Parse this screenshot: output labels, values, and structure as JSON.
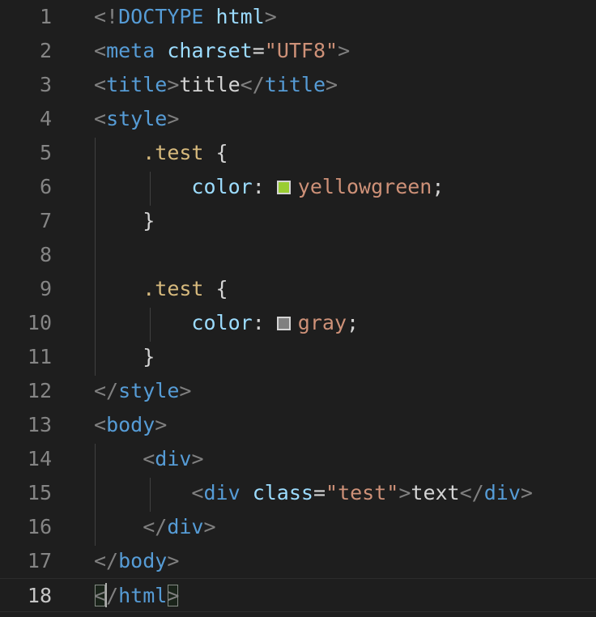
{
  "editor": {
    "lines": [
      {
        "number": "1",
        "tokens": [
          {
            "t": "<!",
            "k": "punct"
          },
          {
            "t": "DOCTYPE",
            "k": "tag"
          },
          {
            "t": " ",
            "k": "text"
          },
          {
            "t": "html",
            "k": "attr"
          },
          {
            "t": ">",
            "k": "punct"
          }
        ]
      },
      {
        "number": "2",
        "tokens": [
          {
            "t": "<",
            "k": "punct"
          },
          {
            "t": "meta",
            "k": "tag"
          },
          {
            "t": " ",
            "k": "text"
          },
          {
            "t": "charset",
            "k": "attr"
          },
          {
            "t": "=",
            "k": "text"
          },
          {
            "t": "\"UTF8\"",
            "k": "str"
          },
          {
            "t": ">",
            "k": "punct"
          }
        ]
      },
      {
        "number": "3",
        "tokens": [
          {
            "t": "<",
            "k": "punct"
          },
          {
            "t": "title",
            "k": "tag"
          },
          {
            "t": ">",
            "k": "punct"
          },
          {
            "t": "title",
            "k": "text"
          },
          {
            "t": "</",
            "k": "punct"
          },
          {
            "t": "title",
            "k": "tag"
          },
          {
            "t": ">",
            "k": "punct"
          }
        ]
      },
      {
        "number": "4",
        "tokens": [
          {
            "t": "<",
            "k": "punct"
          },
          {
            "t": "style",
            "k": "tag"
          },
          {
            "t": ">",
            "k": "punct"
          }
        ]
      },
      {
        "number": "5",
        "tokens": [
          {
            "t": "    ",
            "k": "text"
          },
          {
            "t": ".test",
            "k": "sel"
          },
          {
            "t": " {",
            "k": "text"
          }
        ]
      },
      {
        "number": "6",
        "tokens": [
          {
            "t": "        ",
            "k": "text"
          },
          {
            "t": "color",
            "k": "prop"
          },
          {
            "t": ": ",
            "k": "text"
          },
          {
            "swatch": "#9acd32",
            "name": "swatch-yellowgreen"
          },
          {
            "t": "yellowgreen",
            "k": "val"
          },
          {
            "t": ";",
            "k": "text"
          }
        ]
      },
      {
        "number": "7",
        "tokens": [
          {
            "t": "    }",
            "k": "text"
          }
        ]
      },
      {
        "number": "8",
        "tokens": []
      },
      {
        "number": "9",
        "tokens": [
          {
            "t": "    ",
            "k": "text"
          },
          {
            "t": ".test",
            "k": "sel"
          },
          {
            "t": " {",
            "k": "text"
          }
        ]
      },
      {
        "number": "10",
        "tokens": [
          {
            "t": "        ",
            "k": "text"
          },
          {
            "t": "color",
            "k": "prop"
          },
          {
            "t": ": ",
            "k": "text"
          },
          {
            "swatch": "#808080",
            "name": "swatch-gray"
          },
          {
            "t": "gray",
            "k": "val"
          },
          {
            "t": ";",
            "k": "text"
          }
        ]
      },
      {
        "number": "11",
        "tokens": [
          {
            "t": "    }",
            "k": "text"
          }
        ]
      },
      {
        "number": "12",
        "tokens": [
          {
            "t": "</",
            "k": "punct"
          },
          {
            "t": "style",
            "k": "tag"
          },
          {
            "t": ">",
            "k": "punct"
          }
        ]
      },
      {
        "number": "13",
        "tokens": [
          {
            "t": "<",
            "k": "punct"
          },
          {
            "t": "body",
            "k": "tag"
          },
          {
            "t": ">",
            "k": "punct"
          }
        ]
      },
      {
        "number": "14",
        "tokens": [
          {
            "t": "    ",
            "k": "text"
          },
          {
            "t": "<",
            "k": "punct"
          },
          {
            "t": "div",
            "k": "tag"
          },
          {
            "t": ">",
            "k": "punct"
          }
        ]
      },
      {
        "number": "15",
        "tokens": [
          {
            "t": "        ",
            "k": "text"
          },
          {
            "t": "<",
            "k": "punct"
          },
          {
            "t": "div",
            "k": "tag"
          },
          {
            "t": " ",
            "k": "text"
          },
          {
            "t": "class",
            "k": "attr"
          },
          {
            "t": "=",
            "k": "text"
          },
          {
            "t": "\"test\"",
            "k": "str"
          },
          {
            "t": ">",
            "k": "punct"
          },
          {
            "t": "text",
            "k": "text"
          },
          {
            "t": "</",
            "k": "punct"
          },
          {
            "t": "div",
            "k": "tag"
          },
          {
            "t": ">",
            "k": "punct"
          }
        ]
      },
      {
        "number": "16",
        "tokens": [
          {
            "t": "    ",
            "k": "text"
          },
          {
            "t": "</",
            "k": "punct"
          },
          {
            "t": "div",
            "k": "tag"
          },
          {
            "t": ">",
            "k": "punct"
          }
        ]
      },
      {
        "number": "17",
        "tokens": [
          {
            "t": "</",
            "k": "punct"
          },
          {
            "t": "body",
            "k": "tag"
          },
          {
            "t": ">",
            "k": "punct"
          }
        ]
      },
      {
        "number": "18",
        "current": true,
        "tokens": [
          {
            "t": "<",
            "k": "punct",
            "match": true
          },
          {
            "cursor": true
          },
          {
            "t": "/",
            "k": "punct"
          },
          {
            "t": "html",
            "k": "tag"
          },
          {
            "t": ">",
            "k": "punct",
            "match": true
          }
        ]
      }
    ]
  },
  "colors": {
    "background": "#1e1e1e",
    "line_number": "#858585",
    "line_number_active": "#c6c6c6",
    "punctuation": "#808080",
    "tag": "#569cd6",
    "attribute": "#9cdcfe",
    "string": "#ce9178",
    "text": "#d4d4d4",
    "selector": "#d7ba7d",
    "swatch_yellowgreen": "#9acd32",
    "swatch_gray": "#808080"
  }
}
